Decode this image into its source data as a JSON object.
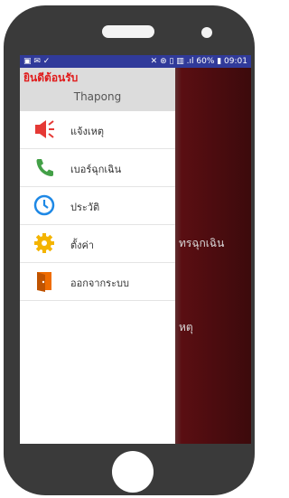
{
  "statusbar": {
    "left_icons": "▣ ✉ ✓",
    "right_text": "✕ ⊛ ▯ ▥ .ıl 60% ▮ 09:01"
  },
  "drawer": {
    "welcome": "ยินดีต้อนรับ",
    "username": "Thapong",
    "items": [
      {
        "label": "แจ้งเหตุ",
        "icon": "megaphone-icon",
        "color": "#e53935"
      },
      {
        "label": "เบอร์ฉุกเฉิน",
        "icon": "phone-icon",
        "color": "#43a047"
      },
      {
        "label": "ประวัติ",
        "icon": "clock-icon",
        "color": "#1e88e5"
      },
      {
        "label": "ตั้งค่า",
        "icon": "gear-icon",
        "color": "#f4b400"
      },
      {
        "label": "ออกจากระบบ",
        "icon": "exit-icon",
        "color": "#ef6c00"
      }
    ]
  },
  "background": {
    "text1": "ทรฉุกเฉิน",
    "text2": "หตุ"
  }
}
